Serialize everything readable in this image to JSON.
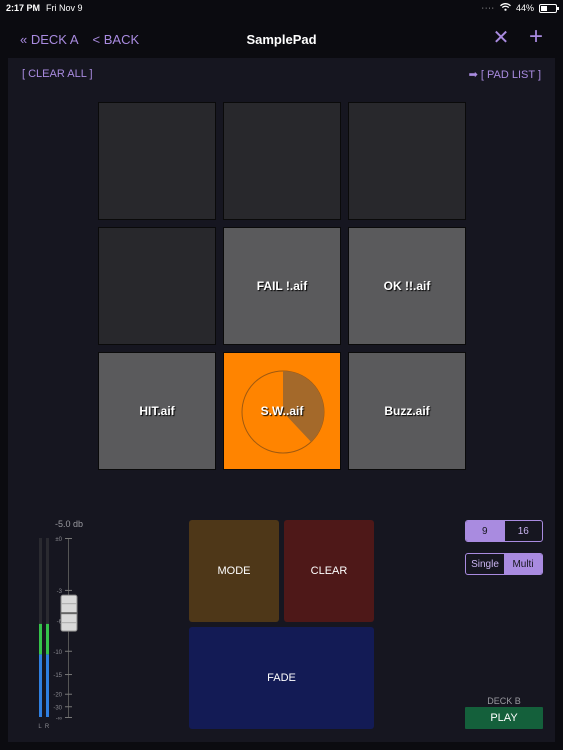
{
  "status_bar": {
    "time": "2:17 PM",
    "date": "Fri Nov 9",
    "battery": "44%",
    "battery_level": 0.44
  },
  "nav": {
    "deck_link": "« DECK A",
    "back_link": "< BACK",
    "title": "SamplePad",
    "close_icon": "close-icon",
    "plus_icon": "plus-icon"
  },
  "toolbar": {
    "clear_all": "[ CLEAR ALL ]",
    "pad_list": "➡ [ PAD LIST ]"
  },
  "pads": [
    {
      "label": "",
      "state": "empty"
    },
    {
      "label": "",
      "state": "empty"
    },
    {
      "label": "",
      "state": "empty"
    },
    {
      "label": "",
      "state": "empty"
    },
    {
      "label": "FAIL !.aif",
      "state": "loaded"
    },
    {
      "label": "OK !!.aif",
      "state": "loaded"
    },
    {
      "label": "HIT.aif",
      "state": "loaded"
    },
    {
      "label": "S.W..aif",
      "state": "active",
      "progress": 0.38
    },
    {
      "label": "Buzz.aif",
      "state": "loaded"
    }
  ],
  "meter": {
    "gain_label": "-5.0 db",
    "scale": [
      "±0",
      "-3",
      "-6",
      "-10",
      "-15",
      "-20",
      "-30",
      "-∞"
    ],
    "channel_labels": [
      "L",
      "R"
    ],
    "level_left": 0.52,
    "level_right": 0.52,
    "fader_position": 0.42
  },
  "controls": {
    "mode": "MODE",
    "clear": "CLEAR",
    "fade": "FADE"
  },
  "grid_size": {
    "options": [
      "9",
      "16"
    ],
    "selected": "9"
  },
  "play_mode": {
    "options": [
      "Single",
      "Multi"
    ],
    "selected": "Multi"
  },
  "deck_b": {
    "label": "DECK B",
    "play": "PLAY"
  },
  "colors": {
    "accent": "#a98be0",
    "active_pad": "#ff8400",
    "mode": "#4e3718",
    "clear": "#4e1818",
    "fade": "#131b55",
    "play": "#14603b"
  }
}
